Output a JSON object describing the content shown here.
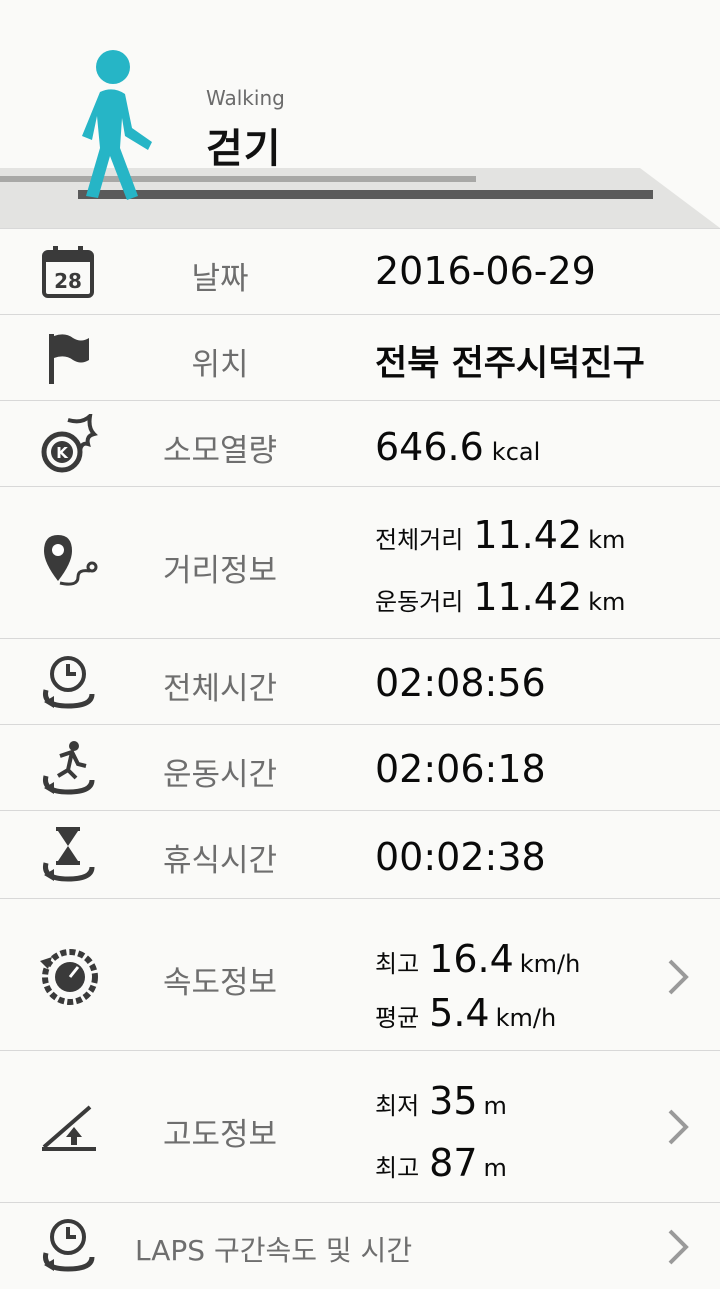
{
  "header": {
    "subtitle": "Walking",
    "title": "걷기"
  },
  "rows": {
    "date": {
      "label": "날짜",
      "value": "2016-06-29",
      "calendar_day": "28"
    },
    "location": {
      "label": "위치",
      "value": "전북 전주시덕진구"
    },
    "calories": {
      "label": "소모열량",
      "value": "646.6",
      "unit": "kcal"
    },
    "distance": {
      "label": "거리정보",
      "total_label": "전체거리",
      "total_value": "11.42",
      "total_unit": "km",
      "exercise_label": "운동거리",
      "exercise_value": "11.42",
      "exercise_unit": "km"
    },
    "total_time": {
      "label": "전체시간",
      "value": "02:08:56"
    },
    "exercise_time": {
      "label": "운동시간",
      "value": "02:06:18"
    },
    "rest_time": {
      "label": "휴식시간",
      "value": "00:02:38"
    },
    "speed": {
      "label": "속도정보",
      "max_label": "최고",
      "max_value": "16.4",
      "max_unit": "km/h",
      "avg_label": "평균",
      "avg_value": "5.4",
      "avg_unit": "km/h"
    },
    "altitude": {
      "label": "고도정보",
      "min_label": "최저",
      "min_value": "35",
      "min_unit": "m",
      "max_label": "최고",
      "max_value": "87",
      "max_unit": "m"
    },
    "laps": {
      "label": "LAPS 구간속도 및 시간"
    }
  },
  "colors": {
    "accent": "#26b5c6",
    "icon": "#3a3a3a",
    "divider": "#d8d8d8"
  }
}
